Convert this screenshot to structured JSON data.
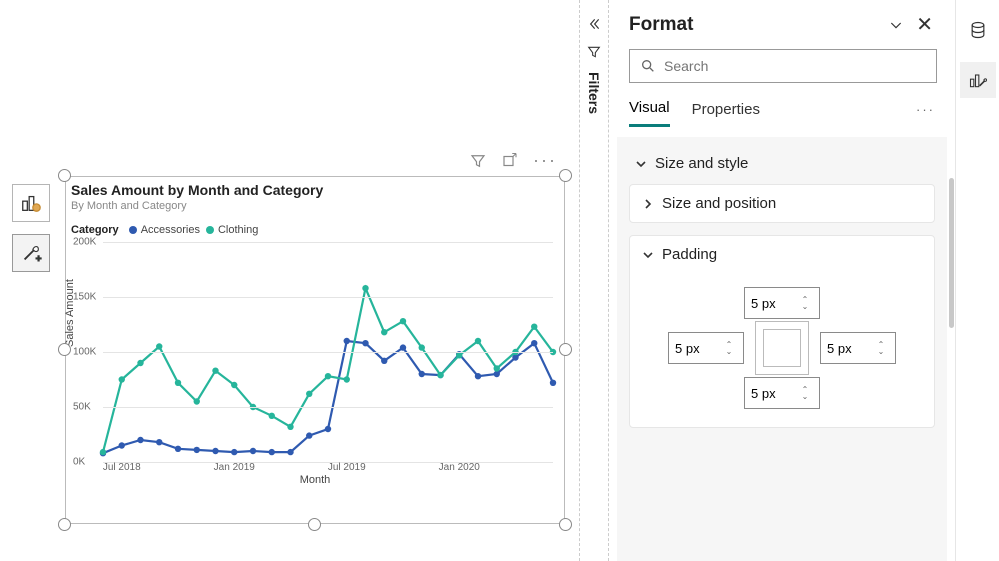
{
  "canvas": {
    "side_build_tooltip": "Build visual",
    "side_format_tooltip": "Format visual"
  },
  "chart_data": {
    "type": "line",
    "title": "Sales Amount by Month and Category",
    "subtitle": "By Month and Category",
    "legend_title": "Category",
    "xlabel": "Month",
    "ylabel": "Sales Amount",
    "ylim": [
      0,
      200000
    ],
    "yticks": [
      "0K",
      "50K",
      "100K",
      "150K",
      "200K"
    ],
    "xticks": [
      "Jul 2018",
      "Jan 2019",
      "Jul 2019",
      "Jan 2020"
    ],
    "x_months": [
      "Jun 2018",
      "Jul 2018",
      "Aug 2018",
      "Sep 2018",
      "Oct 2018",
      "Nov 2018",
      "Dec 2018",
      "Jan 2019",
      "Feb 2019",
      "Mar 2019",
      "Apr 2019",
      "May 2019",
      "Jun 2019",
      "Jul 2019",
      "Aug 2019",
      "Sep 2019",
      "Oct 2019",
      "Nov 2019",
      "Dec 2019",
      "Jan 2020",
      "Feb 2020",
      "Mar 2020",
      "Apr 2020",
      "May 2020",
      "Jun 2020"
    ],
    "series": [
      {
        "name": "Accessories",
        "color": "#2f5ab0",
        "values": [
          8000,
          15000,
          20000,
          18000,
          12000,
          11000,
          10000,
          9000,
          10000,
          9000,
          9000,
          24000,
          30000,
          110000,
          108000,
          92000,
          104000,
          80000,
          79000,
          98000,
          78000,
          80000,
          95000,
          108000,
          72000
        ]
      },
      {
        "name": "Clothing",
        "color": "#26b59b",
        "values": [
          9000,
          75000,
          90000,
          105000,
          72000,
          55000,
          83000,
          70000,
          50000,
          42000,
          32000,
          62000,
          78000,
          75000,
          158000,
          118000,
          128000,
          104000,
          79000,
          97000,
          110000,
          85000,
          100000,
          123000,
          100000
        ]
      }
    ]
  },
  "filters": {
    "label": "Filters"
  },
  "format": {
    "title": "Format",
    "search_placeholder": "Search",
    "tabs": {
      "visual": "Visual",
      "properties": "Properties"
    },
    "sections": {
      "size_style": "Size and style",
      "size_position": "Size and position",
      "padding": "Padding"
    },
    "padding": {
      "top": "5 px",
      "left": "5 px",
      "right": "5 px",
      "bottom": "5 px"
    }
  }
}
